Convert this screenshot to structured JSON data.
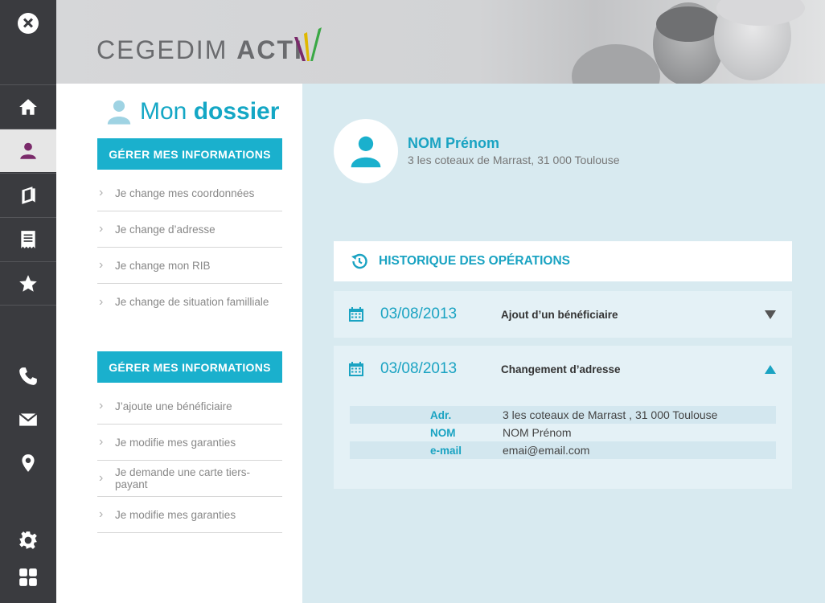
{
  "brand": {
    "name_light": "CEGEDIM ",
    "name_bold": "ACTI",
    "name_tail": "V"
  },
  "rail": {
    "items": [
      "close-icon",
      "home-icon",
      "user-icon",
      "book-icon",
      "receipt-icon",
      "star-icon",
      "phone-icon",
      "mail-icon",
      "location-icon",
      "gear-icon",
      "grid-icon"
    ],
    "active": "user-icon"
  },
  "panel": {
    "title_light": "Mon ",
    "title_bold": "dossier",
    "sections": [
      {
        "button": "GÉRER MES INFORMATIONS",
        "items": [
          "Je change mes coordonnées",
          "Je change d’adresse",
          "Je change mon RIB",
          "Je change de situation familliale"
        ]
      },
      {
        "button": "GÉRER MES INFORMATIONS",
        "items": [
          "J’ajoute une bénéficiaire",
          "Je modifie mes garanties",
          "Je demande une carte tiers-payant",
          "Je modifie mes garanties"
        ]
      }
    ]
  },
  "profile": {
    "name": "NOM Prénom",
    "address": "3 les coteaux de Marrast, 31 000 Toulouse"
  },
  "history": {
    "title": "HISTORIQUE DES OPÉRATIONS",
    "operations": [
      {
        "date": "03/08/2013",
        "label": "Ajout d’un bénéficiaire",
        "expanded": false
      },
      {
        "date": "03/08/2013",
        "label": "Changement d’adresse",
        "expanded": true,
        "details": [
          {
            "key": "Adr.",
            "value": "3 les coteaux de Marrast , 31 000 Toulouse"
          },
          {
            "key": "NOM",
            "value": "NOM Prénom"
          },
          {
            "key": "e-mail",
            "value": "emai@email.com"
          }
        ]
      }
    ]
  },
  "colors": {
    "accent": "#1ab0cd",
    "rail": "#3a3b3f",
    "active_user_icon": "#7a2a6a",
    "background": "#d8eaf0"
  }
}
